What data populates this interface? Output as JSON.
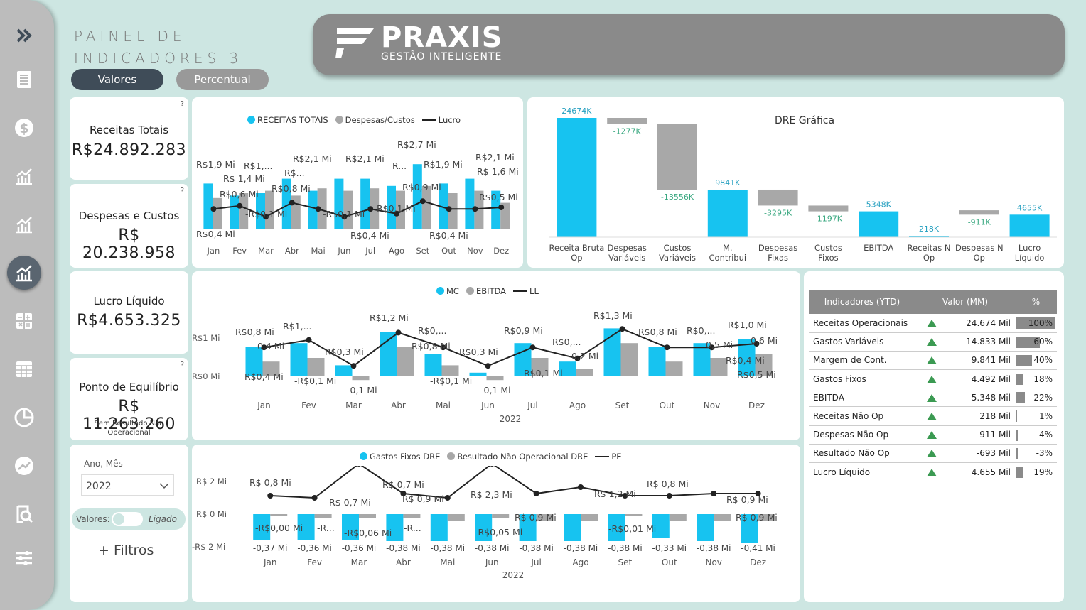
{
  "colors": {
    "accent": "#17c3f0",
    "gray": "#a8a8a8",
    "sidebar": "#bcbcbc",
    "background": "#cde6e2",
    "positive": "#3b9a52"
  },
  "sidebar": {
    "items": [
      {
        "icon": "double-chevron-right-icon"
      },
      {
        "icon": "document-list-icon"
      },
      {
        "icon": "dollar-icon"
      },
      {
        "icon": "bar-chart-icon"
      },
      {
        "icon": "bar-chart-icon"
      },
      {
        "icon": "bar-chart-icon",
        "active": true
      },
      {
        "icon": "calculator-icon"
      },
      {
        "icon": "table-icon"
      },
      {
        "icon": "pie-chart-icon"
      },
      {
        "icon": "trend-line-icon"
      },
      {
        "icon": "search-report-icon"
      },
      {
        "icon": "sliders-icon"
      }
    ]
  },
  "header": {
    "title_line1": "PAINEL DE",
    "title_line2": "INDICADORES 3",
    "btn_valores": "Valores",
    "btn_percentual": "Percentual",
    "logo_name": "PRAXIS",
    "logo_tagline": "GESTÃO INTELIGENTE"
  },
  "kpis": {
    "receitas": {
      "label": "Receitas Totais",
      "value": "R$24.892.283",
      "help": "?"
    },
    "despesas": {
      "label": "Despesas e Custos",
      "value": "R$ 20.238.958",
      "help": "?"
    },
    "lucro": {
      "label": "Lucro Líquido",
      "value": "R$4.653.325"
    },
    "equilibrio": {
      "label": "Ponto de Equilíbrio",
      "value": "R$ 11.263.260",
      "note": "Sem Resultado Não Operacional",
      "help": "?"
    }
  },
  "filters": {
    "slicer_label": "Ano, Mês",
    "slicer_value": "2022",
    "toggle_label": "Valores:",
    "toggle_state": "Ligado",
    "filtros_label": "+ Filtros"
  },
  "chart_data": [
    {
      "type": "bar",
      "id": "receitas-despesas-lucro",
      "legend": [
        "RECEITAS TOTAIS",
        "Despesas/Custos",
        "Lucro"
      ],
      "categories": [
        "Jan",
        "Fev",
        "Mar",
        "Abr",
        "Mai",
        "Jun",
        "Jul",
        "Ago",
        "Set",
        "Out",
        "Nov",
        "Dez"
      ],
      "series": [
        {
          "name": "RECEITAS TOTAIS",
          "values": [
            1.9,
            1.4,
            1.5,
            2.1,
            1.6,
            2.1,
            2.1,
            1.8,
            2.7,
            1.9,
            2.1,
            1.6
          ]
        },
        {
          "name": "Despesas/Custos",
          "values": [
            1.3,
            1.5,
            1.6,
            1.4,
            1.7,
            1.6,
            1.7,
            1.6,
            1.8,
            1.5,
            1.6,
            1.1
          ]
        },
        {
          "name": "Lucro",
          "values": [
            0.4,
            0.6,
            -0.1,
            0.8,
            0.4,
            -0.1,
            0.4,
            0.1,
            0.9,
            0.4,
            0.4,
            0.5
          ]
        }
      ],
      "data_labels": [
        "R$1,9 Mi",
        "R$ 1,4 Mi",
        "R$1,...",
        "R$2,1 Mi",
        "R$...",
        "R$2,1 Mi",
        "R...",
        "R$2,7 Mi",
        "R$1,9 Mi",
        "R$2,1 Mi",
        "R$ 1,6 Mi",
        "R$0,6 Mi",
        "R$0,8 Mi",
        "R$0,9 Mi",
        "R$0,5 Mi",
        "-R$0,1 Mi",
        "-R$0,1 Mi",
        "R$0,1 Mi",
        "R$0,4 Mi",
        "R$0,4 Mi",
        "R$0,4 Mi"
      ]
    },
    {
      "type": "bar",
      "id": "dre-grafica",
      "title": "DRE Gráfica",
      "categories": [
        "Receita Bruta Op",
        "Despesas Variáveis",
        "Custos Variáveis",
        "M. Contribui",
        "Despesas Fixas",
        "Custos Fixos",
        "EBITDA",
        "Receitas N Op",
        "Despesas N Op",
        "Lucro Líquido"
      ],
      "values": [
        24674,
        -1277,
        -13556,
        9841,
        -3295,
        -1197,
        5348,
        218,
        -911,
        4655
      ],
      "value_labels": [
        "24674K",
        "-1277K",
        "-13556K",
        "9841K",
        "-3295K",
        "-1197K",
        "5348K",
        "218K",
        "-911K",
        "4655K"
      ]
    },
    {
      "type": "bar",
      "id": "mc-ebitda-ll",
      "legend": [
        "MC",
        "EBITDA",
        "LL"
      ],
      "x_title": "2022",
      "y_ticks": [
        "R$1 Mi",
        "R$0 Mi"
      ],
      "categories": [
        "Jan",
        "Fev",
        "Mar",
        "Abr",
        "Mai",
        "Jun",
        "Jul",
        "Ago",
        "Set",
        "Out",
        "Nov",
        "Dez"
      ],
      "series": [
        {
          "name": "MC",
          "values": [
            0.8,
            0.9,
            0.3,
            1.2,
            0.6,
            0.1,
            0.9,
            0.4,
            1.3,
            0.8,
            0.9,
            1.0
          ]
        },
        {
          "name": "EBITDA",
          "values": [
            0.4,
            0.5,
            -0.1,
            0.8,
            0.3,
            -0.1,
            0.5,
            0.2,
            0.9,
            0.4,
            0.5,
            0.6
          ]
        },
        {
          "name": "LL",
          "values": [
            0.4,
            0.6,
            -0.1,
            0.8,
            0.4,
            -0.1,
            0.4,
            0.1,
            0.9,
            0.4,
            0.4,
            0.5
          ]
        }
      ],
      "data_labels": [
        "R$0,8 Mi",
        "R$1,...",
        "R$1,2 Mi",
        "R$0,...",
        "R$0,9 Mi",
        "R$0,...",
        "R$1,3 Mi",
        "R$0,8 Mi",
        "R$0,...",
        "R$1,0 Mi",
        "0,4 Mi",
        "R$0,3 Mi",
        "R$0,8 Mi",
        "R$0,3 Mi",
        "0,2 Mi",
        "0,5 Mi",
        "0,6 Mi",
        "R$0,4 Mi",
        "-R$0,1 Mi",
        "-0,1 Mi",
        "-R$0,1 Mi",
        "-0,1 Mi",
        "R$0,1 Mi",
        "R$0,4 Mi",
        "R$0,5 Mi"
      ]
    },
    {
      "type": "bar",
      "id": "gastos-fixos-pe",
      "legend": [
        "Gastos Fixos DRE",
        "Resultado Não Operacional DRE",
        "PE"
      ],
      "x_title": "2022",
      "y_ticks": [
        "R$ 2 Mi",
        "R$ 0 Mi",
        "-R$ 2 Mi"
      ],
      "categories": [
        "Jan",
        "Fev",
        "Mar",
        "Abr",
        "Mai",
        "Jun",
        "Jul",
        "Ago",
        "Set",
        "Out",
        "Nov",
        "Dez"
      ],
      "series": [
        {
          "name": "Gastos Fixos DRE",
          "values": [
            -0.37,
            -0.36,
            -0.36,
            -0.38,
            -0.38,
            -0.38,
            -0.38,
            -0.38,
            -0.38,
            -0.33,
            -0.38,
            -0.41
          ]
        },
        {
          "name": "Resultado Não Operacional DRE",
          "values": [
            0.0,
            -0.05,
            -0.06,
            -0.05,
            -0.1,
            -0.05,
            -0.1,
            -0.1,
            -0.01,
            -0.1,
            -0.1,
            -0.1
          ]
        },
        {
          "name": "PE",
          "values": [
            0.8,
            0.7,
            2.3,
            0.9,
            0.7,
            2.3,
            0.9,
            1.2,
            0.8,
            0.8,
            0.9,
            0.9
          ]
        }
      ],
      "data_labels": [
        "R$ 0,8 Mi",
        "R$ 0,7 Mi",
        "R$ 0,7 Mi",
        "R$ 0,9 Mi",
        "R$ 2,3 Mi",
        "R$ 1,2 Mi",
        "R$ 0,8 Mi",
        "R$ 0,9 Mi",
        "R$ 0,9 Mi",
        "R$ 0,9 Mi",
        "-R$0,00 Mi",
        "-R...",
        "-R$0,06 Mi",
        "-R...",
        "-R$0,05 Mi",
        "-R$0,01 Mi"
      ],
      "bottom_labels": [
        "-0,37 Mi",
        "-0,36 Mi",
        "-0,36 Mi",
        "-0,38 Mi",
        "-0,38 Mi",
        "-0,38 Mi",
        "-0,38 Mi",
        "-0,38 Mi",
        "-0,38 Mi",
        "-0,33 Mi",
        "-0,38 Mi",
        "-0,41 Mi"
      ]
    }
  ],
  "indicators": {
    "headers": [
      "Indicadores (YTD)",
      "Valor (MM)",
      "%"
    ],
    "rows": [
      {
        "name": "Receitas Operacionais",
        "value": "24.674 Mil",
        "pct": "100%",
        "pct_num": 100
      },
      {
        "name": "Gastos Variáveis",
        "value": "14.833 Mil",
        "pct": "60%",
        "pct_num": 60
      },
      {
        "name": "Margem de Cont.",
        "value": "9.841 Mil",
        "pct": "40%",
        "pct_num": 40
      },
      {
        "name": "Gastos Fixos",
        "value": "4.492 Mil",
        "pct": "18%",
        "pct_num": 18
      },
      {
        "name": "EBITDA",
        "value": "5.348 Mil",
        "pct": "22%",
        "pct_num": 22
      },
      {
        "name": "Receitas Não Op",
        "value": "218 Mil",
        "pct": "1%",
        "pct_num": 1
      },
      {
        "name": "Despesas Não Op",
        "value": "911 Mil",
        "pct": "4%",
        "pct_num": 4
      },
      {
        "name": "Resultado Não Op",
        "value": "-693 Mil",
        "pct": "-3%",
        "pct_num": -3
      },
      {
        "name": "Lucro Líquido",
        "value": "4.655 Mil",
        "pct": "19%",
        "pct_num": 19
      }
    ]
  }
}
